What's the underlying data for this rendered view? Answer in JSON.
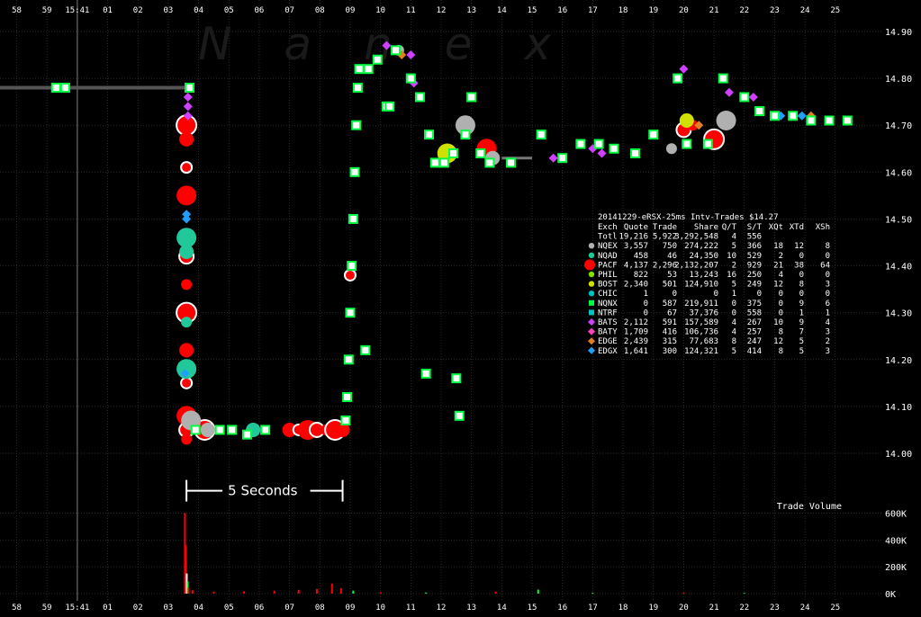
{
  "watermark": "Nanex",
  "colors": {
    "background": "#000000",
    "grid": "#3a3a3a",
    "text": "#ffffff",
    "annotation": "#ffffff",
    "prior_line": "#555555"
  },
  "annotation": {
    "label": "5 Seconds",
    "from_x": 4.6,
    "to_x": 9.75,
    "y_price": 13.97
  },
  "time_ticks": [
    {
      "x": -1,
      "label": "58"
    },
    {
      "x": 0,
      "label": "59"
    },
    {
      "x": 1,
      "label": "15:41"
    },
    {
      "x": 2,
      "label": "01"
    },
    {
      "x": 3,
      "label": "02"
    },
    {
      "x": 4,
      "label": "03"
    },
    {
      "x": 5,
      "label": "04"
    },
    {
      "x": 6,
      "label": "05"
    },
    {
      "x": 7,
      "label": "06"
    },
    {
      "x": 8,
      "label": "07"
    },
    {
      "x": 9,
      "label": "08"
    },
    {
      "x": 10,
      "label": "09"
    },
    {
      "x": 11,
      "label": "10"
    },
    {
      "x": 12,
      "label": "11"
    },
    {
      "x": 13,
      "label": "12"
    },
    {
      "x": 14,
      "label": "13"
    },
    {
      "x": 15,
      "label": "14"
    },
    {
      "x": 16,
      "label": "15"
    },
    {
      "x": 17,
      "label": "16"
    },
    {
      "x": 18,
      "label": "17"
    },
    {
      "x": 19,
      "label": "18"
    },
    {
      "x": 20,
      "label": "19"
    },
    {
      "x": 21,
      "label": "20"
    },
    {
      "x": 22,
      "label": "21"
    },
    {
      "x": 23,
      "label": "22"
    },
    {
      "x": 24,
      "label": "23"
    },
    {
      "x": 25,
      "label": "24"
    },
    {
      "x": 26,
      "label": "25"
    }
  ],
  "chart_data": [
    {
      "type": "scatter",
      "title": "",
      "xlabel": "",
      "ylabel": "",
      "xlim": [
        -1.55,
        27.55
      ],
      "ylim": [
        13.95,
        14.915
      ],
      "yticks": [
        14.0,
        14.1,
        14.2,
        14.3,
        14.4,
        14.5,
        14.6,
        14.7,
        14.8,
        14.9
      ],
      "ytick_labels": [
        "14.00",
        "14.10",
        "14.20",
        "14.30",
        "14.40",
        "14.50",
        "14.60",
        "14.70",
        "14.80",
        "14.90"
      ],
      "grid": true,
      "prior_price": {
        "x_from": -1.55,
        "x_to": 4.6,
        "y": 14.78
      },
      "series": [
        {
          "exchange": "NQEX",
          "color": "#00ff40",
          "shape": "square",
          "points": [
            [
              0.3,
              14.78
            ],
            [
              0.6,
              14.78
            ],
            [
              4.7,
              14.78
            ],
            [
              4.9,
              14.05
            ],
            [
              5.7,
              14.05
            ],
            [
              6.1,
              14.05
            ],
            [
              6.6,
              14.04
            ],
            [
              7.2,
              14.05
            ],
            [
              9.85,
              14.07
            ],
            [
              9.9,
              14.12
            ],
            [
              9.95,
              14.2
            ],
            [
              10.0,
              14.3
            ],
            [
              10.05,
              14.4
            ],
            [
              10.1,
              14.5
            ],
            [
              10.15,
              14.6
            ],
            [
              10.2,
              14.7
            ],
            [
              10.25,
              14.78
            ],
            [
              10.3,
              14.82
            ],
            [
              10.6,
              14.82
            ],
            [
              10.9,
              14.84
            ],
            [
              11.2,
              14.74
            ],
            [
              11.5,
              14.86
            ],
            [
              12.0,
              14.8
            ],
            [
              12.3,
              14.76
            ],
            [
              12.6,
              14.68
            ],
            [
              12.8,
              14.62
            ],
            [
              13.1,
              14.62
            ],
            [
              13.4,
              14.64
            ],
            [
              13.8,
              14.68
            ],
            [
              14.0,
              14.76
            ],
            [
              14.3,
              14.64
            ],
            [
              14.6,
              14.62
            ],
            [
              15.3,
              14.62
            ],
            [
              16.3,
              14.68
            ],
            [
              17.0,
              14.63
            ],
            [
              17.6,
              14.66
            ],
            [
              18.2,
              14.66
            ],
            [
              18.7,
              14.65
            ],
            [
              19.4,
              14.64
            ],
            [
              20.0,
              14.68
            ],
            [
              20.8,
              14.8
            ],
            [
              21.1,
              14.66
            ],
            [
              21.8,
              14.66
            ],
            [
              22.3,
              14.8
            ],
            [
              23.0,
              14.76
            ],
            [
              23.5,
              14.73
            ],
            [
              24.0,
              14.72
            ],
            [
              24.6,
              14.72
            ],
            [
              25.2,
              14.71
            ],
            [
              25.8,
              14.71
            ],
            [
              26.4,
              14.71
            ],
            [
              10.5,
              14.22
            ],
            [
              12.5,
              14.17
            ],
            [
              13.5,
              14.16
            ],
            [
              13.6,
              14.08
            ],
            [
              11.3,
              14.74
            ]
          ]
        },
        {
          "exchange": "PACF",
          "color": "#ff0000",
          "shape": "circle",
          "points": [
            [
              4.6,
              14.7
            ],
            [
              4.6,
              14.67
            ],
            [
              4.6,
              14.61
            ],
            [
              4.6,
              14.55
            ],
            [
              4.6,
              14.42
            ],
            [
              4.6,
              14.36
            ],
            [
              4.6,
              14.3
            ],
            [
              4.6,
              14.22
            ],
            [
              4.6,
              14.15
            ],
            [
              4.6,
              14.08
            ],
            [
              4.6,
              14.05
            ],
            [
              4.6,
              14.03
            ],
            [
              5.2,
              14.05
            ],
            [
              8.0,
              14.05
            ],
            [
              8.3,
              14.05
            ],
            [
              8.6,
              14.05
            ],
            [
              8.9,
              14.05
            ],
            [
              9.2,
              14.05
            ],
            [
              9.5,
              14.05
            ],
            [
              9.75,
              14.05
            ],
            [
              10.0,
              14.38
            ],
            [
              14.5,
              14.65
            ],
            [
              21.0,
              14.69
            ],
            [
              21.3,
              14.7
            ],
            [
              22.0,
              14.67
            ]
          ]
        },
        {
          "exchange": "NQAD",
          "color": "#20c89a",
          "shape": "circle",
          "points": [
            [
              4.6,
              14.46
            ],
            [
              4.6,
              14.43
            ],
            [
              4.6,
              14.28
            ],
            [
              4.6,
              14.18
            ],
            [
              6.8,
              14.05
            ]
          ]
        },
        {
          "exchange": "BATS",
          "color": "#d040ff",
          "shape": "diamond",
          "points": [
            [
              4.65,
              14.76
            ],
            [
              4.65,
              14.74
            ],
            [
              4.65,
              14.72
            ],
            [
              11.2,
              14.87
            ],
            [
              12.0,
              14.85
            ],
            [
              12.1,
              14.79
            ],
            [
              21.0,
              14.82
            ],
            [
              22.5,
              14.77
            ],
            [
              23.3,
              14.76
            ],
            [
              16.7,
              14.63
            ],
            [
              18.0,
              14.65
            ],
            [
              18.3,
              14.64
            ]
          ]
        },
        {
          "exchange": "NQNX",
          "color": "#b0b0b0",
          "shape": "circle",
          "points": [
            [
              4.75,
              14.07
            ],
            [
              5.3,
              14.05
            ],
            [
              11.6,
              14.86
            ],
            [
              13.8,
              14.7
            ],
            [
              14.7,
              14.63
            ],
            [
              20.6,
              14.65
            ],
            [
              22.4,
              14.71
            ]
          ]
        },
        {
          "exchange": "EDGX",
          "color": "#1fa0ff",
          "shape": "diamond",
          "points": [
            [
              4.6,
              14.51
            ],
            [
              4.6,
              14.5
            ],
            [
              4.55,
              14.17
            ],
            [
              24.2,
              14.72
            ],
            [
              24.9,
              14.72
            ]
          ]
        },
        {
          "exchange": "EDGE",
          "color": "#e08020",
          "shape": "diamond",
          "points": [
            [
              11.7,
              14.85
            ],
            [
              21.5,
              14.7
            ],
            [
              25.2,
              14.72
            ]
          ]
        },
        {
          "exchange": "BOST",
          "color": "#d0e000",
          "shape": "circle",
          "points": [
            [
              13.2,
              14.64
            ],
            [
              21.1,
              14.71
            ]
          ]
        }
      ]
    },
    {
      "type": "bar",
      "title": "Trade Volume",
      "xlabel": "",
      "ylabel": "",
      "ylim": [
        0,
        630000
      ],
      "yticks": [
        0,
        200000,
        400000,
        600000
      ],
      "ytick_labels": [
        "0K",
        "200K",
        "400K",
        "600K"
      ],
      "bars": [
        {
          "x": 4.55,
          "y": 600000,
          "color": "#ff0000"
        },
        {
          "x": 4.58,
          "y": 360000,
          "color": "#ff0000"
        },
        {
          "x": 4.61,
          "y": 150000,
          "color": "#ffffff"
        },
        {
          "x": 4.64,
          "y": 90000,
          "color": "#00ff40"
        },
        {
          "x": 4.67,
          "y": 45000,
          "color": "#ff0000"
        },
        {
          "x": 4.8,
          "y": 25000,
          "color": "#ff0000"
        },
        {
          "x": 5.5,
          "y": 15000,
          "color": "#ff0000"
        },
        {
          "x": 6.5,
          "y": 18000,
          "color": "#ff0000"
        },
        {
          "x": 7.5,
          "y": 22000,
          "color": "#ff0000"
        },
        {
          "x": 8.3,
          "y": 28000,
          "color": "#ff0000"
        },
        {
          "x": 8.9,
          "y": 35000,
          "color": "#ff0000"
        },
        {
          "x": 9.4,
          "y": 75000,
          "color": "#ff0000"
        },
        {
          "x": 9.7,
          "y": 40000,
          "color": "#ff0000"
        },
        {
          "x": 10.1,
          "y": 22000,
          "color": "#00ff40"
        },
        {
          "x": 11.0,
          "y": 10000,
          "color": "#ff0000"
        },
        {
          "x": 12.5,
          "y": 8000,
          "color": "#00ff40"
        },
        {
          "x": 14.8,
          "y": 15000,
          "color": "#ff0000"
        },
        {
          "x": 16.2,
          "y": 30000,
          "color": "#00ff40"
        },
        {
          "x": 18.0,
          "y": 6000,
          "color": "#00ff40"
        },
        {
          "x": 21.0,
          "y": 8000,
          "color": "#ff0000"
        },
        {
          "x": 23.0,
          "y": 5000,
          "color": "#00ff40"
        }
      ]
    }
  ],
  "stats_table": {
    "title": "20141229-eRSX-25ms Intv-Trades $14.27",
    "header": [
      "Exch",
      "Quote",
      "Trade",
      "Share",
      "Q/T",
      "S/T",
      "XQt",
      "XTd",
      "XSh"
    ],
    "rows": [
      {
        "exch": "Totl",
        "quote": "19,216",
        "trade": "5,922",
        "share": "3,292,548",
        "qt": "4",
        "st": "556",
        "xqt": "",
        "xtd": "",
        "xsh": "",
        "color": "",
        "shape": ""
      },
      {
        "exch": "NQEX",
        "quote": "3,557",
        "trade": "750",
        "share": "274,222",
        "qt": "5",
        "st": "366",
        "xqt": "18",
        "xtd": "12",
        "xsh": "8",
        "color": "#b0b0b0",
        "shape": "circle"
      },
      {
        "exch": "NQAD",
        "quote": "458",
        "trade": "46",
        "share": "24,350",
        "qt": "10",
        "st": "529",
        "xqt": "2",
        "xtd": "0",
        "xsh": "0",
        "color": "#20c89a",
        "shape": "circle"
      },
      {
        "exch": "PACF",
        "quote": "4,137",
        "trade": "2,296",
        "share": "2,132,207",
        "qt": "2",
        "st": "929",
        "xqt": "21",
        "xtd": "38",
        "xsh": "64",
        "color": "#ff0000",
        "shape": "bigcircle"
      },
      {
        "exch": "PHIL",
        "quote": "822",
        "trade": "53",
        "share": "13,243",
        "qt": "16",
        "st": "250",
        "xqt": "4",
        "xtd": "0",
        "xsh": "0",
        "color": "#80e000",
        "shape": "circle"
      },
      {
        "exch": "BOST",
        "quote": "2,340",
        "trade": "501",
        "share": "124,910",
        "qt": "5",
        "st": "249",
        "xqt": "12",
        "xtd": "8",
        "xsh": "3",
        "color": "#d0e000",
        "shape": "circle"
      },
      {
        "exch": "CHIC",
        "quote": "1",
        "trade": "0",
        "share": "0",
        "qt": "1",
        "st": "0",
        "xqt": "0",
        "xtd": "0",
        "xsh": "0",
        "color": "#00c0c0",
        "shape": "circle"
      },
      {
        "exch": "NQNX",
        "quote": "0",
        "trade": "587",
        "share": "219,911",
        "qt": "0",
        "st": "375",
        "xqt": "0",
        "xtd": "9",
        "xsh": "6",
        "color": "#00ff40",
        "shape": "square"
      },
      {
        "exch": "NTRF",
        "quote": "0",
        "trade": "67",
        "share": "37,376",
        "qt": "0",
        "st": "558",
        "xqt": "0",
        "xtd": "1",
        "xsh": "1",
        "color": "#00c0c0",
        "shape": "square"
      },
      {
        "exch": "BATS",
        "quote": "2,112",
        "trade": "591",
        "share": "157,589",
        "qt": "4",
        "st": "267",
        "xqt": "10",
        "xtd": "9",
        "xsh": "4",
        "color": "#d040ff",
        "shape": "diamond"
      },
      {
        "exch": "BATY",
        "quote": "1,709",
        "trade": "416",
        "share": "106,736",
        "qt": "4",
        "st": "257",
        "xqt": "8",
        "xtd": "7",
        "xsh": "3",
        "color": "#ff40c0",
        "shape": "diamond"
      },
      {
        "exch": "EDGE",
        "quote": "2,439",
        "trade": "315",
        "share": "77,683",
        "qt": "8",
        "st": "247",
        "xqt": "12",
        "xtd": "5",
        "xsh": "2",
        "color": "#e08020",
        "shape": "diamond"
      },
      {
        "exch": "EDGX",
        "quote": "1,641",
        "trade": "300",
        "share": "124,321",
        "qt": "5",
        "st": "414",
        "xqt": "8",
        "xtd": "5",
        "xsh": "3",
        "color": "#1fa0ff",
        "shape": "diamond"
      }
    ]
  }
}
